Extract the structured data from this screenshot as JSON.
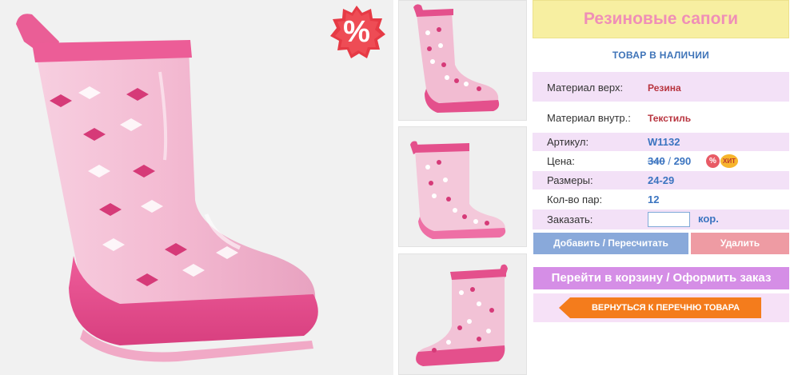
{
  "product": {
    "title": "Резиновые сапоги",
    "stock_status": "ТОВАР В НАЛИЧИИ",
    "discount_symbol": "%"
  },
  "details": [
    {
      "label": "Материал верх:",
      "value": "Резина"
    },
    {
      "label": "Материал внутр.:",
      "value": "Текстиль"
    },
    {
      "label": "Артикул:",
      "value": "W1132"
    },
    {
      "label": "Цена:",
      "old_price": "340",
      "separator": "/",
      "price": "290",
      "badge_sale": "%",
      "badge_hit": "ХИТ"
    },
    {
      "label": "Размеры:",
      "value": "24-29"
    },
    {
      "label": "Кол-во пар:",
      "value": "12"
    },
    {
      "label": "Заказать:",
      "input_value": "",
      "unit": "кор."
    }
  ],
  "buttons": {
    "add": "Добавить / Пересчитать",
    "delete": "Удалить",
    "cart": "Перейти в корзину / Оформить заказ",
    "back": "ВЕРНУТЬСЯ К ПЕРЕЧНЮ ТОВАРА"
  },
  "colors": {
    "title_bg": "#f7efa1",
    "title_text": "#ef8fb7",
    "row_pink": "#f3e1f7",
    "accent_blue": "#3b74c0",
    "accent_red": "#b8343f",
    "btn_add": "#89a9da",
    "btn_delete": "#ee9ba3",
    "btn_cart": "#d58ee6",
    "btn_back": "#f47c1c",
    "boot_pink": "#f2b6cd",
    "boot_dark_pink": "#e4508c"
  },
  "icons": {
    "product_image": "pink-rubber-boot-image",
    "discount_badge": "discount-starburst-icon",
    "back_arrow": "arrow-left-icon"
  }
}
